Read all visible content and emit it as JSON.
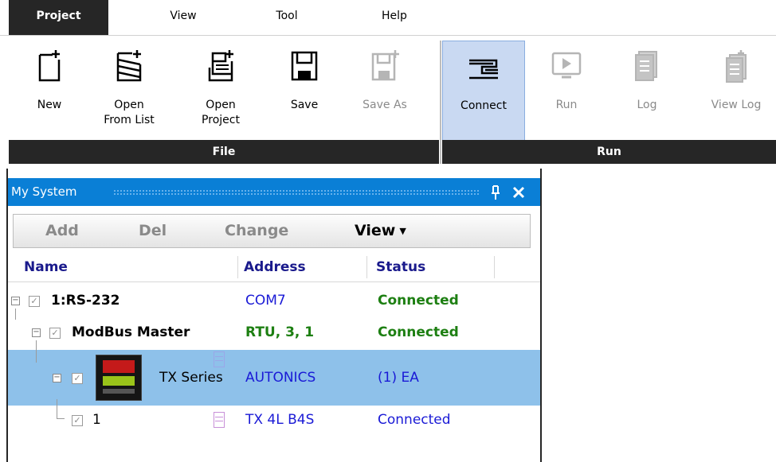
{
  "menu": {
    "project": "Project",
    "view": "View",
    "tool": "Tool",
    "help": "Help"
  },
  "ribbon": {
    "file_buttons": [
      {
        "label": "New",
        "icon": "new-file-icon",
        "enabled": true
      },
      {
        "label": "Open\nFrom List",
        "icon": "open-from-list-icon",
        "enabled": true
      },
      {
        "label": "Open\nProject",
        "icon": "open-project-icon",
        "enabled": true
      },
      {
        "label": "Save",
        "icon": "save-icon",
        "enabled": true
      },
      {
        "label": "Save As",
        "icon": "save-as-icon",
        "enabled": false
      }
    ],
    "run_buttons": [
      {
        "label": "Connect",
        "icon": "connect-icon",
        "enabled": true,
        "active": true
      },
      {
        "label": "Run",
        "icon": "run-icon",
        "enabled": false
      },
      {
        "label": "Log",
        "icon": "log-icon",
        "enabled": false
      },
      {
        "label": "View Log",
        "icon": "view-log-icon",
        "enabled": false
      }
    ],
    "groups": {
      "file": "File",
      "run": "Run"
    }
  },
  "panel": {
    "title": "My System",
    "toolbar": {
      "add": "Add",
      "del": "Del",
      "change": "Change",
      "view": "View"
    },
    "columns": {
      "name": "Name",
      "address": "Address",
      "status": "Status"
    },
    "rows": [
      {
        "name": "1:RS-232",
        "address": "COM7",
        "status": "Connected"
      },
      {
        "name": "ModBus Master",
        "address": "RTU, 3, 1",
        "status": "Connected"
      },
      {
        "name": "TX Series",
        "address": "AUTONICS",
        "status": "(1) EA"
      },
      {
        "name": "1",
        "address": "TX 4L B4S",
        "status": "Connected"
      }
    ]
  },
  "colors": {
    "accent": "#0a7fd6",
    "selected_row": "#8ec1ea",
    "connected_green": "#1d7f12",
    "link_blue": "#1a1ad6",
    "dark_bar": "#262626"
  }
}
